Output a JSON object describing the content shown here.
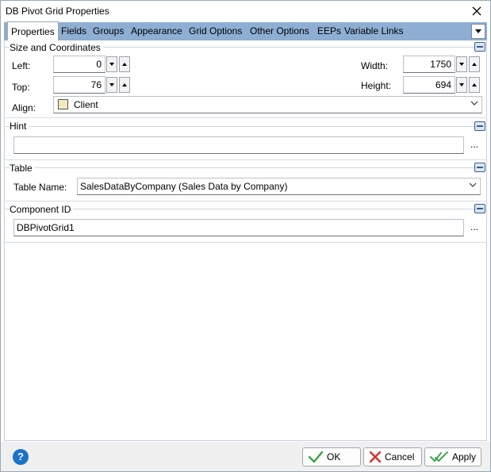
{
  "window": {
    "title": "DB Pivot Grid Properties"
  },
  "tabs": [
    {
      "label": "Properties"
    },
    {
      "label": "Fields"
    },
    {
      "label": "Groups"
    },
    {
      "label": "Appearance"
    },
    {
      "label": "Grid Options"
    },
    {
      "label": "Other Options"
    },
    {
      "label": "EEPs"
    },
    {
      "label": "Variable Links"
    }
  ],
  "size_coords": {
    "header": "Size and Coordinates",
    "left_label": "Left:",
    "left_value": "0",
    "top_label": "Top:",
    "top_value": "76",
    "width_label": "Width:",
    "width_value": "1750",
    "height_label": "Height:",
    "height_value": "694",
    "align_label": "Align:",
    "align_value": "Client"
  },
  "hint": {
    "header": "Hint",
    "value": "",
    "ellipsis": "..."
  },
  "table": {
    "header": "Table",
    "label": "Table Name:",
    "value": "SalesDataByCompany  (Sales Data by Company)"
  },
  "component": {
    "header": "Component ID",
    "value": "DBPivotGrid1",
    "ellipsis": "..."
  },
  "footer": {
    "help": "?",
    "ok_label": "OK",
    "cancel_label": "Cancel",
    "apply_label": "Apply"
  },
  "colors": {
    "tab_strip": "#8eaed3",
    "help": "#1a73c8",
    "ok_check": "#2e9d3a",
    "cancel_x": "#d9302c"
  }
}
